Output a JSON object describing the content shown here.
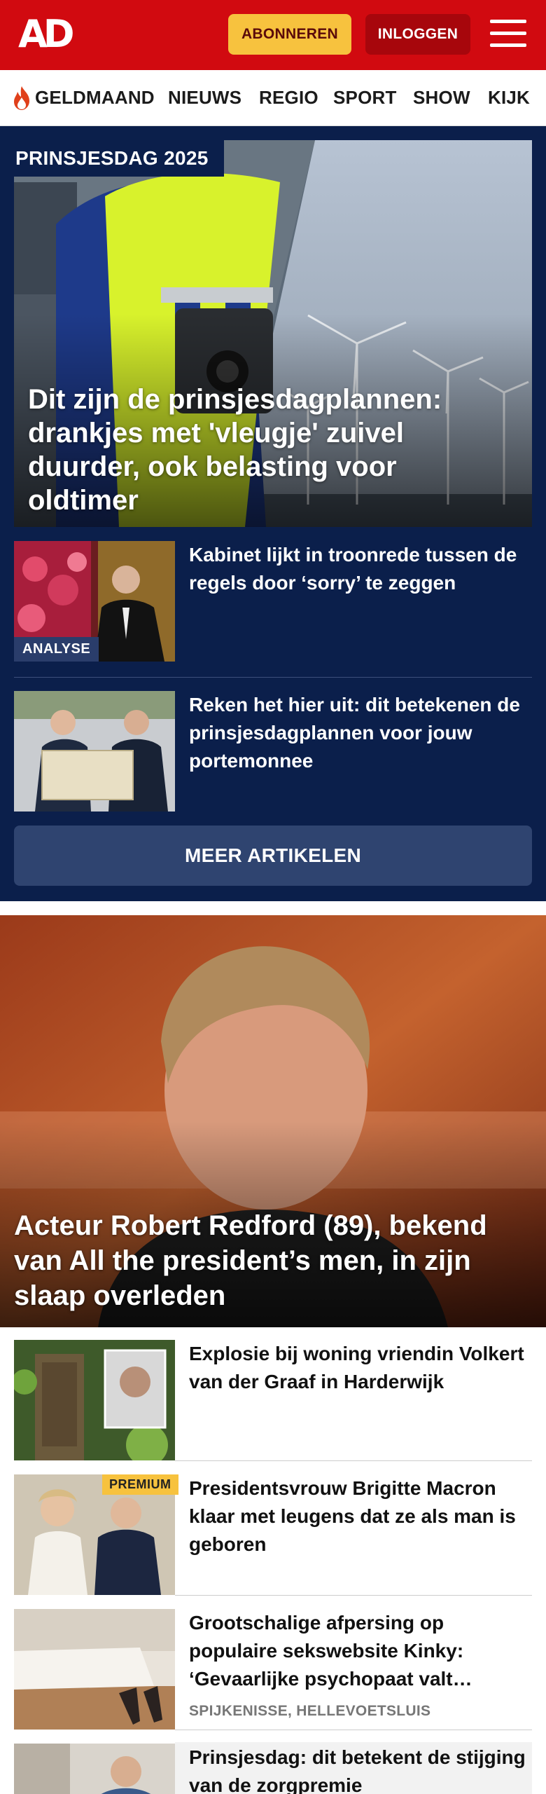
{
  "header": {
    "logo": "AD",
    "subscribe_label": "ABONNEREN",
    "login_label": "INLOGGEN",
    "brand_color": "#d10a10",
    "menu_icon": "hamburger-icon"
  },
  "nav": {
    "items": [
      {
        "label": "GELDMAAND",
        "icon": "flame-icon"
      },
      {
        "label": "NIEUWS"
      },
      {
        "label": "REGIO"
      },
      {
        "label": "SPORT"
      },
      {
        "label": "SHOW"
      },
      {
        "label": "KIJK"
      }
    ]
  },
  "prinsjesdag": {
    "label": "PRINSJESDAG 2025",
    "hero_title": "Dit zijn de prinsjesdagplannen: drankjes met 'vleugje' zuivel duurder, ook belasting voor oldtimer",
    "articles": [
      {
        "title": "Kabinet lijkt in troonrede tussen de regels door ‘sorry’ te zeggen",
        "badge": "ANALYSE"
      },
      {
        "title": "Reken het hier uit: dit betekenen de prinsjesdagplannen voor jouw portemonnee"
      }
    ],
    "more_label": "MEER ARTIKELEN",
    "section_color": "#0b1f4b"
  },
  "featured": {
    "title": "Acteur Robert Redford (89), bekend van All the president’s men, in zijn slaap overleden"
  },
  "list": [
    {
      "title": "Explosie bij woning vriendin Volkert van der Graaf in Harderwijk"
    },
    {
      "title": "Presidentsvrouw Brigitte Macron klaar met leugens dat ze als man is geboren",
      "badge": "PREMIUM"
    },
    {
      "title": "Grootschalige afpersing op populaire sekswebsite Kinky: ‘Gevaarlijke psychopaat valt…",
      "location": "SPIJKENISSE, HELLEVOETSLUIS"
    },
    {
      "title": "Prinsjesdag: dit betekent de stijging van de zorgpremie"
    }
  ]
}
